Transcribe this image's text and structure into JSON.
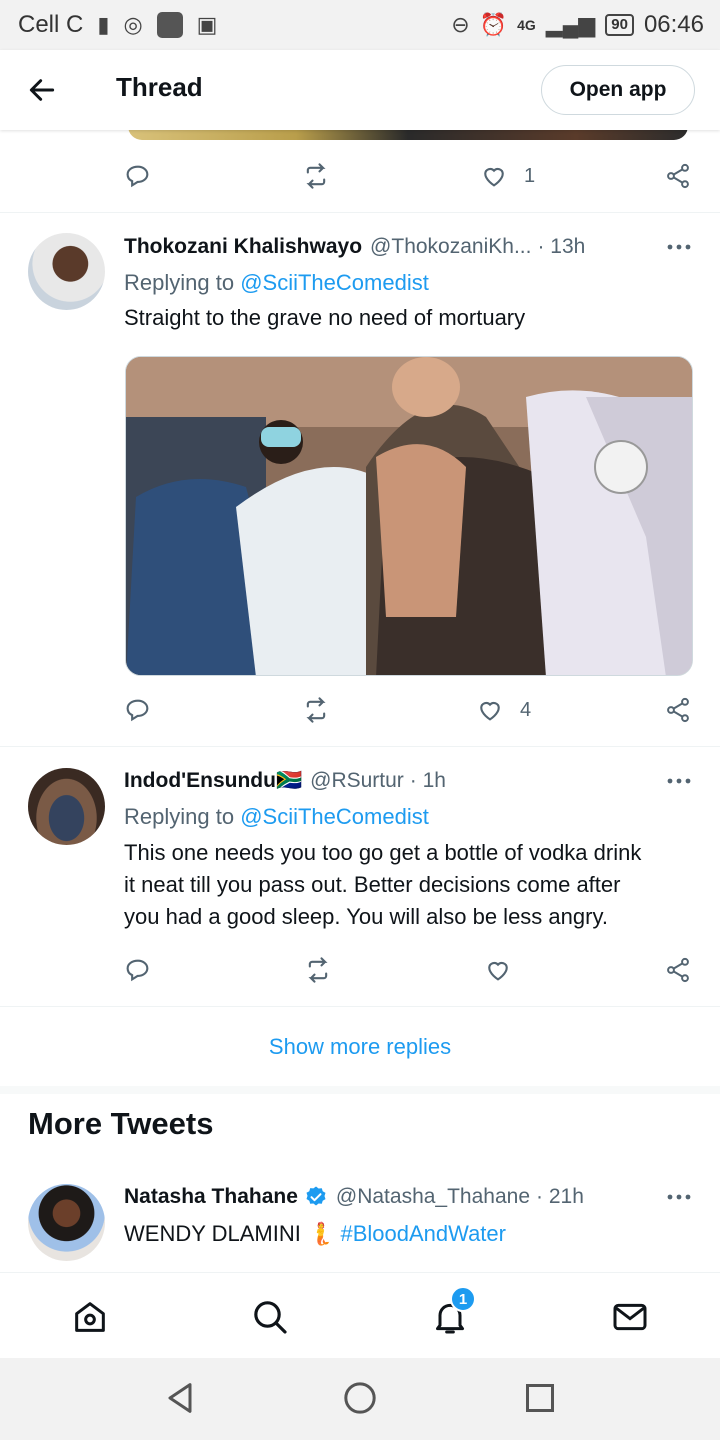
{
  "status_bar": {
    "carrier": "Cell C",
    "network": "4G",
    "battery": "90",
    "time": "06:46"
  },
  "header": {
    "title": "Thread",
    "open_app_label": "Open app"
  },
  "tweets": [
    {
      "like_count": "1"
    },
    {
      "name": "Thokozani Khalishwayo",
      "handle": "@ThokozaniKh...",
      "time": "· 13h",
      "replying_prefix": "Replying to",
      "replying_to": "@SciiTheComedist",
      "text": "Straight to the grave no need of mortuary",
      "like_count": "4"
    },
    {
      "name": "Indod'Ensundu🇿🇦",
      "handle": "@RSurtur",
      "time": "· 1h",
      "replying_prefix": "Replying to",
      "replying_to": "@SciiTheComedist",
      "text_lines": [
        "This one needs you too go get a bottle of vodka drink",
        "it neat till you pass out. Better decisions come after",
        "you had a good sleep. You will also be less angry."
      ],
      "like_count": ""
    }
  ],
  "show_more_replies": "Show more replies",
  "more_tweets": {
    "heading": "More Tweets",
    "tweet": {
      "name": "Natasha Thahane",
      "handle": "@Natasha_Thahane",
      "time": "· 21h",
      "text": "WENDY DLAMINI 🧜",
      "hashtag": "#BloodAndWater"
    }
  },
  "bottom_nav": {
    "notifications_badge": "1",
    "icons": [
      "home-icon",
      "search-icon",
      "bell-icon",
      "mail-icon"
    ]
  },
  "colors": {
    "accent": "#1d9bf0",
    "muted": "#536471",
    "text": "#0f1419"
  }
}
